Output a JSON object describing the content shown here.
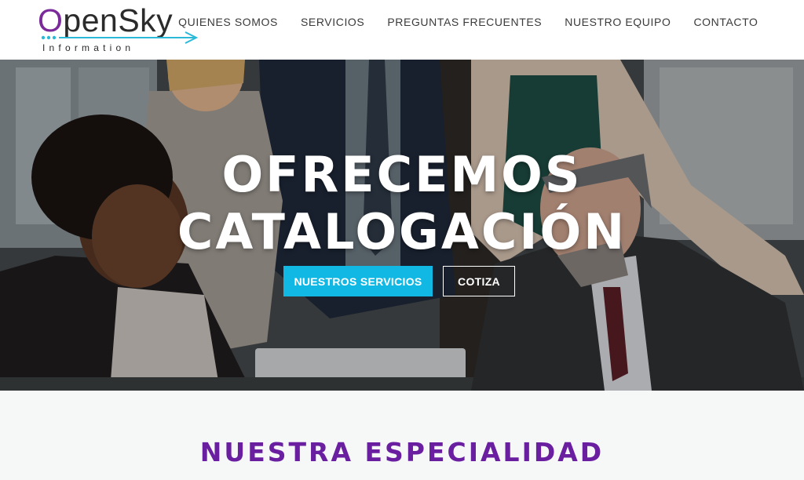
{
  "brand": {
    "name_first": "O",
    "name_rest": "penSky",
    "tagline": "Information",
    "colors": {
      "purple": "#7b2a9a",
      "cyan": "#2bb9d8"
    }
  },
  "nav": {
    "items": [
      {
        "label": "QUIENES SOMOS"
      },
      {
        "label": "SERVICIOS"
      },
      {
        "label": "PREGUNTAS FRECUENTES"
      },
      {
        "label": "NUESTRO EQUIPO"
      },
      {
        "label": "CONTACTO"
      }
    ]
  },
  "hero": {
    "title": "OFRECEMOS CATALOGACIÓN",
    "primary_button": "NUESTROS SERVICIOS",
    "secondary_button": "COTIZA",
    "background": "office-team-photo",
    "colors": {
      "button": "#12b8e4"
    }
  },
  "section": {
    "title": "NUESTRA ESPECIALIDAD",
    "colors": {
      "title": "#6a1fa0"
    }
  }
}
